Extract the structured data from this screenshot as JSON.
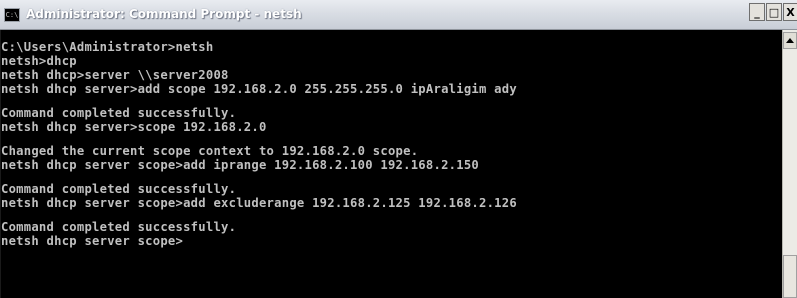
{
  "window": {
    "title": "Administrator: Command Prompt - netsh",
    "icon": "cmd-icon",
    "controls": {
      "minimize": "_",
      "maximize": "□",
      "close": "X"
    }
  },
  "console": {
    "lines": [
      "C:\\Users\\Administrator>netsh",
      "netsh>dhcp",
      "netsh dhcp>server \\\\server2008",
      "netsh dhcp server>add scope 192.168.2.0 255.255.255.0 ipAraligim ady",
      "",
      "Command completed successfully.",
      "netsh dhcp server>scope 192.168.2.0",
      "",
      "Changed the current scope context to 192.168.2.0 scope.",
      "netsh dhcp server scope>add iprange 192.168.2.100 192.168.2.150",
      "",
      "Command completed successfully.",
      "netsh dhcp server scope>add excluderange 192.168.2.125 192.168.2.126",
      "",
      "Command completed successfully.",
      "netsh dhcp server scope>"
    ],
    "text_color": "#c0c0c0",
    "background_color": "#000000"
  }
}
